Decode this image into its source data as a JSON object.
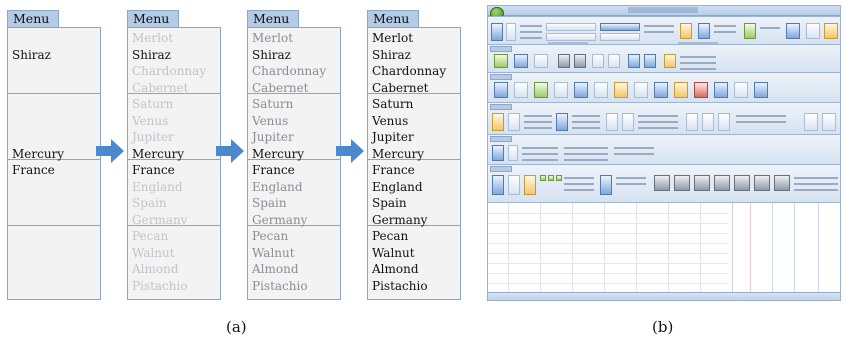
{
  "menu_label": "Menu",
  "colors": {
    "accent": "#b4cbe6",
    "border": "#8ca5c4",
    "arrow": "#4a88cf",
    "bright_text": "#111111",
    "dim_text": "#c4c4c6"
  },
  "panels": [
    {
      "groups": [
        {
          "items": [
            {
              "text": "",
              "state": "dim"
            },
            {
              "text": "Shiraz",
              "state": "bright"
            },
            {
              "text": "",
              "state": "dim"
            },
            {
              "text": "",
              "state": "dim"
            }
          ]
        },
        {
          "items": [
            {
              "text": "",
              "state": "dim"
            },
            {
              "text": "",
              "state": "dim"
            },
            {
              "text": "",
              "state": "dim"
            },
            {
              "text": "Mercury",
              "state": "bright"
            }
          ]
        },
        {
          "items": [
            {
              "text": "France",
              "state": "bright"
            },
            {
              "text": "",
              "state": "dim"
            },
            {
              "text": "",
              "state": "dim"
            },
            {
              "text": "",
              "state": "dim"
            }
          ]
        },
        {
          "items": [
            {
              "text": "",
              "state": "dim"
            },
            {
              "text": "",
              "state": "dim"
            },
            {
              "text": "",
              "state": "dim"
            },
            {
              "text": "",
              "state": "dim"
            }
          ]
        }
      ]
    },
    {
      "groups": [
        {
          "items": [
            {
              "text": "Merlot",
              "state": "dim"
            },
            {
              "text": "Shiraz",
              "state": "bright"
            },
            {
              "text": "Chardonnay",
              "state": "dim"
            },
            {
              "text": "Cabernet",
              "state": "dim"
            }
          ]
        },
        {
          "items": [
            {
              "text": "Saturn",
              "state": "dim"
            },
            {
              "text": "Venus",
              "state": "dim"
            },
            {
              "text": "Jupiter",
              "state": "dim"
            },
            {
              "text": "Mercury",
              "state": "bright"
            }
          ]
        },
        {
          "items": [
            {
              "text": "France",
              "state": "bright"
            },
            {
              "text": "England",
              "state": "dim"
            },
            {
              "text": "Spain",
              "state": "dim"
            },
            {
              "text": "Germany",
              "state": "dim"
            }
          ]
        },
        {
          "items": [
            {
              "text": "Pecan",
              "state": "dim"
            },
            {
              "text": "Walnut",
              "state": "dim"
            },
            {
              "text": "Almond",
              "state": "dim"
            },
            {
              "text": "Pistachio",
              "state": "dim"
            }
          ]
        }
      ]
    },
    {
      "groups": [
        {
          "items": [
            {
              "text": "Merlot",
              "state": "mid"
            },
            {
              "text": "Shiraz",
              "state": "bright"
            },
            {
              "text": "Chardonnay",
              "state": "mid"
            },
            {
              "text": "Cabernet",
              "state": "mid"
            }
          ]
        },
        {
          "items": [
            {
              "text": "Saturn",
              "state": "mid"
            },
            {
              "text": "Venus",
              "state": "mid"
            },
            {
              "text": "Jupiter",
              "state": "mid"
            },
            {
              "text": "Mercury",
              "state": "bright"
            }
          ]
        },
        {
          "items": [
            {
              "text": "France",
              "state": "bright"
            },
            {
              "text": "England",
              "state": "mid"
            },
            {
              "text": "Spain",
              "state": "mid"
            },
            {
              "text": "Germany",
              "state": "mid"
            }
          ]
        },
        {
          "items": [
            {
              "text": "Pecan",
              "state": "mid"
            },
            {
              "text": "Walnut",
              "state": "mid"
            },
            {
              "text": "Almond",
              "state": "mid"
            },
            {
              "text": "Pistachio",
              "state": "mid"
            }
          ]
        }
      ]
    },
    {
      "groups": [
        {
          "items": [
            {
              "text": "Merlot",
              "state": "bright"
            },
            {
              "text": "Shiraz",
              "state": "bright"
            },
            {
              "text": "Chardonnay",
              "state": "bright"
            },
            {
              "text": "Cabernet",
              "state": "bright"
            }
          ]
        },
        {
          "items": [
            {
              "text": "Saturn",
              "state": "bright"
            },
            {
              "text": "Venus",
              "state": "bright"
            },
            {
              "text": "Jupiter",
              "state": "bright"
            },
            {
              "text": "Mercury",
              "state": "bright"
            }
          ]
        },
        {
          "items": [
            {
              "text": "France",
              "state": "bright"
            },
            {
              "text": "England",
              "state": "bright"
            },
            {
              "text": "Spain",
              "state": "bright"
            },
            {
              "text": "Germany",
              "state": "bright"
            }
          ]
        },
        {
          "items": [
            {
              "text": "Pecan",
              "state": "bright"
            },
            {
              "text": "Walnut",
              "state": "bright"
            },
            {
              "text": "Almond",
              "state": "bright"
            },
            {
              "text": "Pistachio",
              "state": "bright"
            }
          ]
        }
      ]
    }
  ],
  "arrows": [
    "arrow-right-icon",
    "arrow-right-icon",
    "arrow-right-icon"
  ],
  "captions": {
    "a": "(a)",
    "b": "(b)"
  }
}
